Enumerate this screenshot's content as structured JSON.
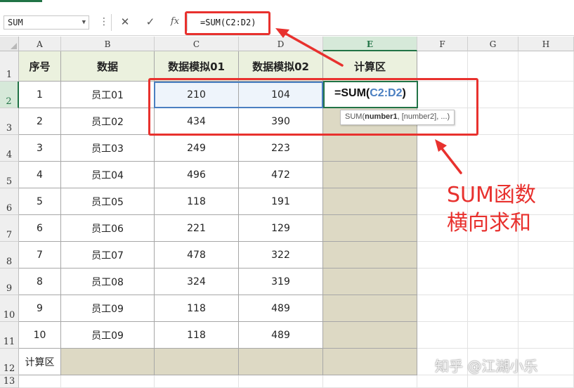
{
  "formula_bar": {
    "name_box": "SUM",
    "cancel_icon": "✕",
    "enter_icon": "✓",
    "fx_icon": "fx",
    "formula": "=SUM(C2:D2)"
  },
  "columns": [
    "A",
    "B",
    "C",
    "D",
    "E",
    "F",
    "G",
    "H"
  ],
  "rows": [
    "1",
    "2",
    "3",
    "4",
    "5",
    "6",
    "7",
    "8",
    "9",
    "10",
    "11",
    "12",
    "13"
  ],
  "headers": {
    "a": "序号",
    "b": "数据",
    "c": "数据模拟01",
    "d": "数据模拟02",
    "e": "计算区"
  },
  "table": [
    {
      "a": "1",
      "b": "员工01",
      "c": "210",
      "d": "104"
    },
    {
      "a": "2",
      "b": "员工02",
      "c": "434",
      "d": "390"
    },
    {
      "a": "3",
      "b": "员工03",
      "c": "249",
      "d": "223"
    },
    {
      "a": "4",
      "b": "员工04",
      "c": "496",
      "d": "472"
    },
    {
      "a": "5",
      "b": "员工05",
      "c": "118",
      "d": "191"
    },
    {
      "a": "6",
      "b": "员工06",
      "c": "221",
      "d": "129"
    },
    {
      "a": "7",
      "b": "员工07",
      "c": "478",
      "d": "322"
    },
    {
      "a": "8",
      "b": "员工08",
      "c": "324",
      "d": "319"
    },
    {
      "a": "9",
      "b": "员工09",
      "c": "118",
      "d": "489"
    },
    {
      "a": "10",
      "b": "员工09",
      "c": "118",
      "d": "489"
    }
  ],
  "footer_label": "计算区",
  "editing_cell": {
    "prefix": "=SUM(",
    "ref": "C2:D2",
    "suffix": ")"
  },
  "tooltip": {
    "fn": "SUM(",
    "arg1": "number1",
    "rest": ", [number2], ...)"
  },
  "annotation": {
    "line1": "SUM函数",
    "line2": "横向求和"
  },
  "watermark": "知乎 @江湖小乐",
  "colors": {
    "accent_red": "#e8312e",
    "header_fill": "#ebf1de",
    "calc_fill": "#ddd9c4",
    "excel_green": "#217346",
    "ref_blue": "#4a7fc1"
  }
}
